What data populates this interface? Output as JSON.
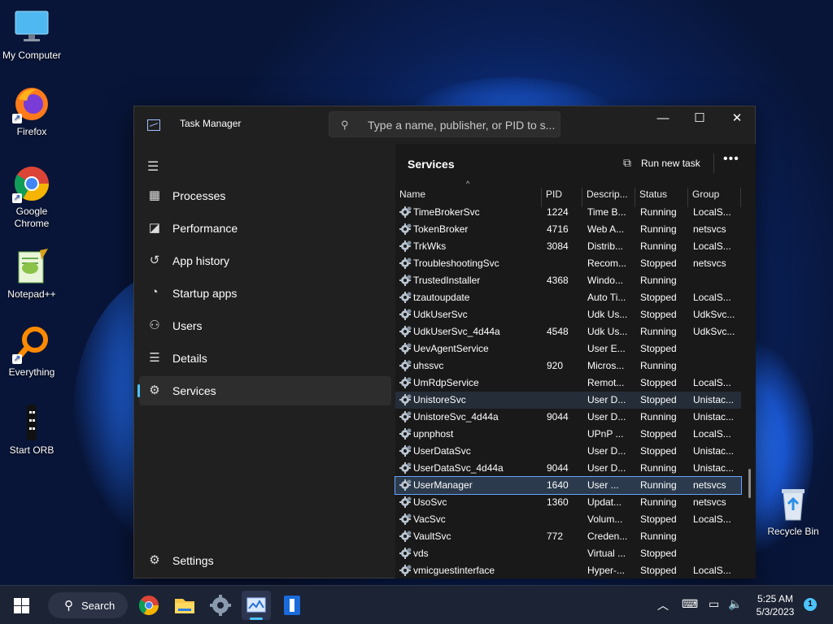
{
  "desktop": {
    "icons": [
      {
        "label": "My Computer",
        "icon": "monitor-icon"
      },
      {
        "label": "Firefox",
        "icon": "firefox-icon"
      },
      {
        "label": "Google Chrome",
        "icon": "chrome-icon"
      },
      {
        "label": "Notepad++",
        "icon": "notepadpp-icon"
      },
      {
        "label": "Everything",
        "icon": "everything-search-icon"
      },
      {
        "label": "Start ORB",
        "icon": "start-orb-icon"
      },
      {
        "label": "Recycle Bin",
        "icon": "recycle-bin-icon"
      }
    ]
  },
  "window": {
    "title": "Task Manager",
    "search_placeholder": "Type a name, publisher, or PID to s...",
    "controls": {
      "minimize": "—",
      "maximize": "☐",
      "close": "✕"
    }
  },
  "nav": {
    "items": [
      {
        "label": "Processes",
        "icon": "processes-icon"
      },
      {
        "label": "Performance",
        "icon": "performance-icon"
      },
      {
        "label": "App history",
        "icon": "app-history-icon"
      },
      {
        "label": "Startup apps",
        "icon": "startup-apps-icon"
      },
      {
        "label": "Users",
        "icon": "users-icon"
      },
      {
        "label": "Details",
        "icon": "details-icon"
      },
      {
        "label": "Services",
        "icon": "services-icon",
        "active": true
      }
    ],
    "settings_label": "Settings"
  },
  "main": {
    "title": "Services",
    "run_new_task": "Run new task",
    "more": "•••",
    "columns": [
      "Name",
      "PID",
      "Descrip...",
      "Status",
      "Group"
    ],
    "rows": [
      {
        "name": "TimeBrokerSvc",
        "pid": "1224",
        "desc": "Time B...",
        "status": "Running",
        "group": "LocalS..."
      },
      {
        "name": "TokenBroker",
        "pid": "4716",
        "desc": "Web A...",
        "status": "Running",
        "group": "netsvcs"
      },
      {
        "name": "TrkWks",
        "pid": "3084",
        "desc": "Distrib...",
        "status": "Running",
        "group": "LocalS..."
      },
      {
        "name": "TroubleshootingSvc",
        "pid": "",
        "desc": "Recom...",
        "status": "Stopped",
        "group": "netsvcs"
      },
      {
        "name": "TrustedInstaller",
        "pid": "4368",
        "desc": "Windo...",
        "status": "Running",
        "group": ""
      },
      {
        "name": "tzautoupdate",
        "pid": "",
        "desc": "Auto Ti...",
        "status": "Stopped",
        "group": "LocalS..."
      },
      {
        "name": "UdkUserSvc",
        "pid": "",
        "desc": "Udk Us...",
        "status": "Stopped",
        "group": "UdkSvc..."
      },
      {
        "name": "UdkUserSvc_4d44a",
        "pid": "4548",
        "desc": "Udk Us...",
        "status": "Running",
        "group": "UdkSvc..."
      },
      {
        "name": "UevAgentService",
        "pid": "",
        "desc": "User E...",
        "status": "Stopped",
        "group": ""
      },
      {
        "name": "uhssvc",
        "pid": "920",
        "desc": "Micros...",
        "status": "Running",
        "group": ""
      },
      {
        "name": "UmRdpService",
        "pid": "",
        "desc": "Remot...",
        "status": "Stopped",
        "group": "LocalS..."
      },
      {
        "name": "UnistoreSvc",
        "pid": "",
        "desc": "User D...",
        "status": "Stopped",
        "group": "Unistac..."
      },
      {
        "name": "UnistoreSvc_4d44a",
        "pid": "9044",
        "desc": "User D...",
        "status": "Running",
        "group": "Unistac..."
      },
      {
        "name": "upnphost",
        "pid": "",
        "desc": "UPnP ...",
        "status": "Stopped",
        "group": "LocalS..."
      },
      {
        "name": "UserDataSvc",
        "pid": "",
        "desc": "User D...",
        "status": "Stopped",
        "group": "Unistac..."
      },
      {
        "name": "UserDataSvc_4d44a",
        "pid": "9044",
        "desc": "User D...",
        "status": "Running",
        "group": "Unistac..."
      },
      {
        "name": "UserManager",
        "pid": "1640",
        "desc": "User ...",
        "status": "Running",
        "group": "netsvcs"
      },
      {
        "name": "UsoSvc",
        "pid": "1360",
        "desc": "Updat...",
        "status": "Running",
        "group": "netsvcs"
      },
      {
        "name": "VacSvc",
        "pid": "",
        "desc": "Volum...",
        "status": "Stopped",
        "group": "LocalS..."
      },
      {
        "name": "VaultSvc",
        "pid": "772",
        "desc": "Creden...",
        "status": "Running",
        "group": ""
      },
      {
        "name": "vds",
        "pid": "",
        "desc": "Virtual ...",
        "status": "Stopped",
        "group": ""
      },
      {
        "name": "vmicguestinterface",
        "pid": "",
        "desc": "Hyper-...",
        "status": "Stopped",
        "group": "LocalS..."
      }
    ]
  },
  "taskbar": {
    "search_label": "Search",
    "apps": [
      "chrome-icon",
      "file-explorer-icon",
      "settings-icon",
      "task-manager-icon",
      "app-icon"
    ],
    "time": "5:25 AM",
    "date": "5/3/2023",
    "notification_count": "1"
  }
}
